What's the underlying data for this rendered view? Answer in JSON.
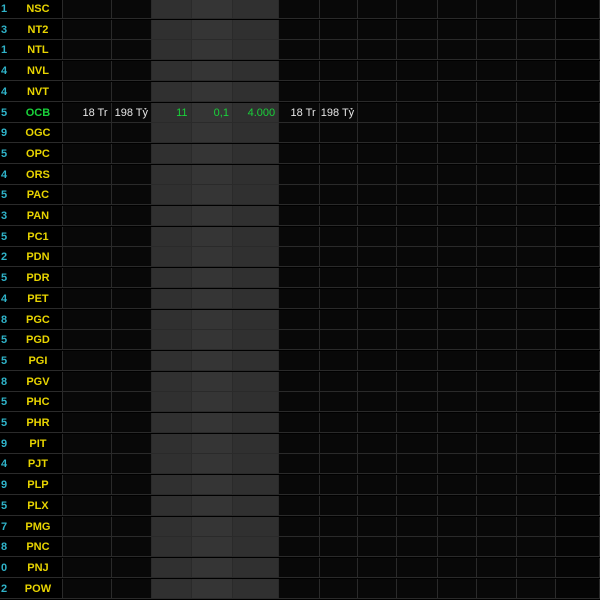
{
  "rows": [
    {
      "idx": "1",
      "sym": "NSC"
    },
    {
      "idx": "3",
      "sym": "NT2"
    },
    {
      "idx": "1",
      "sym": "NTL"
    },
    {
      "idx": "4",
      "sym": "NVL"
    },
    {
      "idx": "4",
      "sym": "NVT"
    },
    {
      "idx": "5",
      "sym": "OCB",
      "v1": "18 Tr",
      "v2": "198 Tỷ",
      "v3": "11",
      "v4": "0,1",
      "v5": "4.000",
      "v6": "18 Tr",
      "v7": "198 Tỷ"
    },
    {
      "idx": "9",
      "sym": "OGC"
    },
    {
      "idx": "5",
      "sym": "OPC"
    },
    {
      "idx": "4",
      "sym": "ORS"
    },
    {
      "idx": "5",
      "sym": "PAC"
    },
    {
      "idx": "3",
      "sym": "PAN"
    },
    {
      "idx": "5",
      "sym": "PC1"
    },
    {
      "idx": "2",
      "sym": "PDN"
    },
    {
      "idx": "5",
      "sym": "PDR"
    },
    {
      "idx": "4",
      "sym": "PET"
    },
    {
      "idx": "8",
      "sym": "PGC"
    },
    {
      "idx": "5",
      "sym": "PGD"
    },
    {
      "idx": "5",
      "sym": "PGI"
    },
    {
      "idx": "8",
      "sym": "PGV"
    },
    {
      "idx": "5",
      "sym": "PHC"
    },
    {
      "idx": "5",
      "sym": "PHR"
    },
    {
      "idx": "9",
      "sym": "PIT"
    },
    {
      "idx": "4",
      "sym": "PJT"
    },
    {
      "idx": "9",
      "sym": "PLP"
    },
    {
      "idx": "5",
      "sym": "PLX"
    },
    {
      "idx": "7",
      "sym": "PMG"
    },
    {
      "idx": "8",
      "sym": "PNC"
    },
    {
      "idx": "0",
      "sym": "PNJ"
    },
    {
      "idx": "2",
      "sym": "POW"
    }
  ],
  "colors": {
    "symbol": "#e8d400",
    "symbol_active": "#19d23a",
    "index": "#2fb3c9",
    "value_up": "#19d23a",
    "value_neutral": "#e6e6e6",
    "band_light": "#303030",
    "band_dark": "#080808"
  }
}
